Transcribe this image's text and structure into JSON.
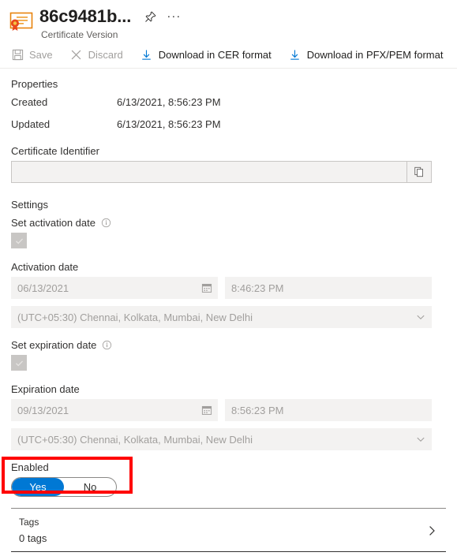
{
  "header": {
    "icon": "certificate-icon",
    "title": "86c9481b...",
    "subtitle": "Certificate Version",
    "pin_icon": "pin-icon",
    "more_icon": "ellipsis-icon"
  },
  "commandbar": {
    "save_label": "Save",
    "discard_label": "Discard",
    "download_cer_label": "Download in CER format",
    "download_pfx_label": "Download in PFX/PEM format"
  },
  "properties": {
    "section_title": "Properties",
    "rows": [
      {
        "label": "Created",
        "value": "6/13/2021, 8:56:23 PM"
      },
      {
        "label": "Updated",
        "value": "6/13/2021, 8:56:23 PM"
      }
    ],
    "certificate_identifier": {
      "label": "Certificate Identifier",
      "value": "",
      "copy_icon": "copy-icon"
    }
  },
  "settings": {
    "section_title": "Settings",
    "set_activation_date": {
      "label": "Set activation date",
      "info_icon": "info-icon",
      "checked": "✓"
    },
    "activation_date": {
      "label": "Activation date",
      "date": "06/13/2021",
      "time": "8:46:23 PM",
      "timezone": "(UTC+05:30) Chennai, Kolkata, Mumbai, New Delhi",
      "calendar_icon": "calendar-icon",
      "chevron_icon": "chevron-down-icon"
    },
    "set_expiration_date": {
      "label": "Set expiration date",
      "info_icon": "info-icon",
      "checked": "✓"
    },
    "expiration_date": {
      "label": "Expiration date",
      "date": "09/13/2021",
      "time": "8:56:23 PM",
      "timezone": "(UTC+05:30) Chennai, Kolkata, Mumbai, New Delhi",
      "calendar_icon": "calendar-icon",
      "chevron_icon": "chevron-down-icon"
    },
    "enabled": {
      "label": "Enabled",
      "yes_label": "Yes",
      "no_label": "No",
      "selected": "Yes",
      "highlight_color": "#ff0000",
      "accent_color": "#0078d4"
    }
  },
  "tags": {
    "label": "Tags",
    "count_text": "0 tags",
    "chevron_icon": "chevron-right-icon"
  }
}
